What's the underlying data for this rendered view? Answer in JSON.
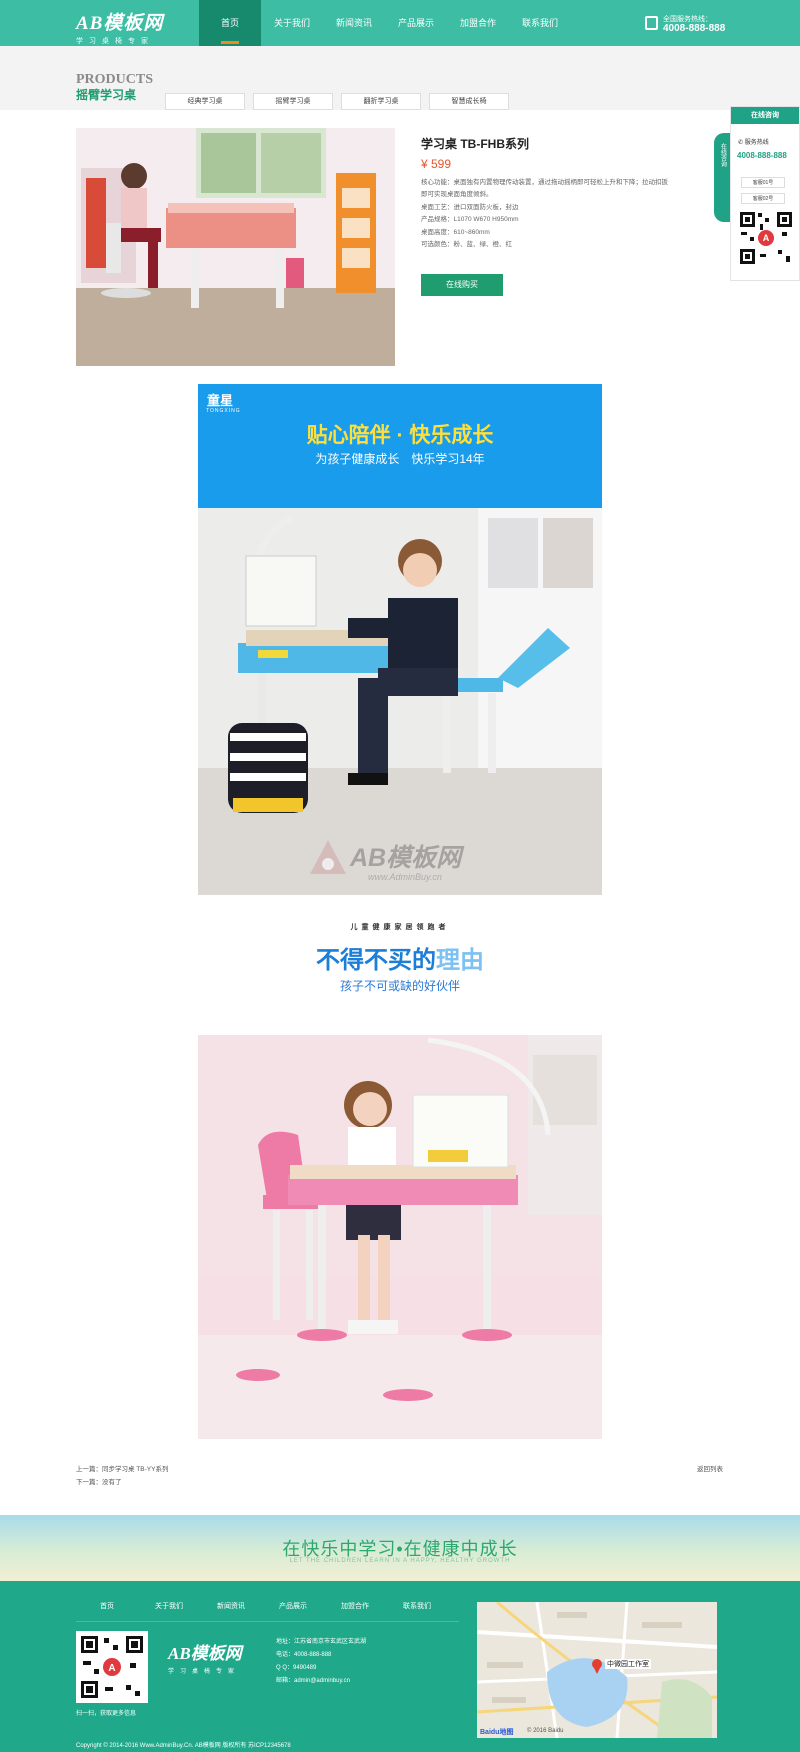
{
  "header": {
    "logo_main": "AB模板网",
    "logo_sub": "学习桌椅专家",
    "nav": [
      "首页",
      "关于我们",
      "新闻资讯",
      "产品展示",
      "加盟合作",
      "联系我们"
    ],
    "hotline_label": "全国服务热线：",
    "hotline": "4008-888-888"
  },
  "products_block": {
    "title_en": "PRODUCTS",
    "title_cn": "摇臂学习桌",
    "tabs": [
      "经典学习桌",
      "摇臂学习桌",
      "翻折学习桌",
      "智慧成长椅"
    ]
  },
  "product": {
    "name": "学习桌 TB-FHB系列",
    "price": "¥ 599",
    "specs": [
      "核心功能：桌面独有内置物理传动装置，通过拖动摇柄即可轻松上升和下降；拉动扣扳",
      "即可实现桌面角度倾斜。",
      "桌面工艺：进口双面防火板，封边",
      "产品规格：L1070 W670 H950mm",
      "桌面高度：610~860mm",
      "可选颜色：粉、蓝、绿、橙、红"
    ],
    "buy_label": "在线购买"
  },
  "side_panel": {
    "title": "在线咨询",
    "tab_text": "在线咨询",
    "phone_label": "服务热线",
    "phone": "4008-888-888",
    "qq1": "客服01号",
    "qq2": "客服02号"
  },
  "detail": {
    "brand": "童星",
    "brand_sub": "TONGXING",
    "banner_title": "贴心陪伴 · 快乐成长",
    "banner_sub": "为孩子健康成长　快乐学习14年",
    "watermark": "AB模板网",
    "watermark_url": "www.AdminBuy.cn",
    "reason_kicker": "儿童健康家居领跑者",
    "reason_title_a": "不得不买的",
    "reason_title_b": "理由",
    "reason_sub": "孩子不可或缺的好伙伴"
  },
  "pager": {
    "prev": "上一篇：同步学习桌 TB-YY系列",
    "next": "下一篇：没有了",
    "back": "返回列表"
  },
  "slogan": {
    "cn": "在快乐中学习•在健康中成长",
    "en": "LET THE CHILDREN LEARN IN A HAPPY, HEALTHY GROWTH"
  },
  "footer": {
    "nav": [
      "首页",
      "关于我们",
      "新闻资讯",
      "产品展示",
      "加盟合作",
      "联系我们"
    ],
    "scan_text": "扫一扫，获取更多信息",
    "logo_main": "AB模板网",
    "logo_sub": "学习桌椅专家",
    "address": "地址：江苏省南京市玄武区玄武湖",
    "tel": "电话：4008-888-888",
    "qq": "Q Q：9490489",
    "email": "邮箱：admin@adminbuy.cn",
    "copyright": "Copyright © 2014-2016 Www.AdminBuy.Cn. AB模板网 版权所有 苏ICP12345678",
    "map_label": "中微园工作室",
    "map_brand": "Baidu地图",
    "map_copy": "© 2016 Baidu"
  }
}
